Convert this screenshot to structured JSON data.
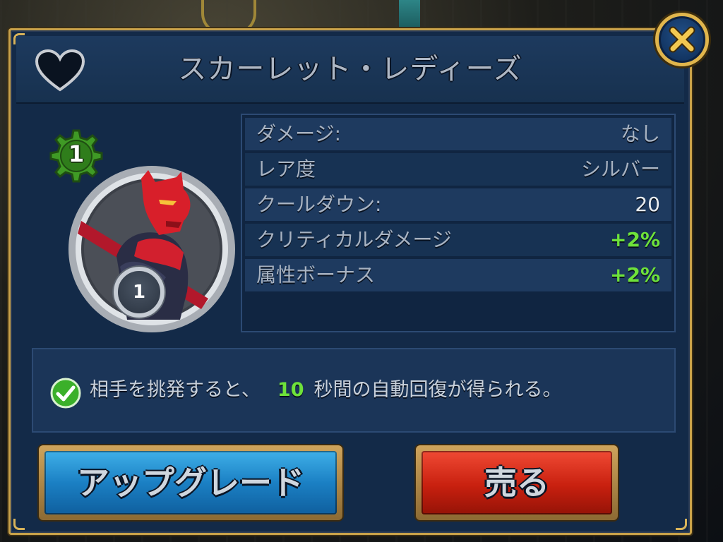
{
  "dialog": {
    "title": "スカーレット・レディーズ",
    "favorite_icon": "heart-outline-icon",
    "close_icon": "close-x-icon"
  },
  "item": {
    "level": "1",
    "rank": "1"
  },
  "stats": [
    {
      "label": "ダメージ:",
      "value": "なし"
    },
    {
      "label": "レア度",
      "value": "シルバー"
    },
    {
      "label": "クールダウン:",
      "value": "20"
    },
    {
      "label": "クリティカルダメージ",
      "value": "+2%"
    },
    {
      "label": "属性ボーナス",
      "value": "+2%"
    }
  ],
  "description": {
    "prefix": "相手を挑発すると、",
    "number": "10",
    "suffix": "秒間の自動回復が得られる。"
  },
  "buttons": {
    "upgrade_label": "アップグレード",
    "sell_label": "売る"
  },
  "colors": {
    "panel_bg": "#132a48",
    "frame_gold": "#c9a24a",
    "bonus_green": "#6ee23a",
    "upgrade_blue": "#1b80c4",
    "sell_red": "#c8200f"
  }
}
